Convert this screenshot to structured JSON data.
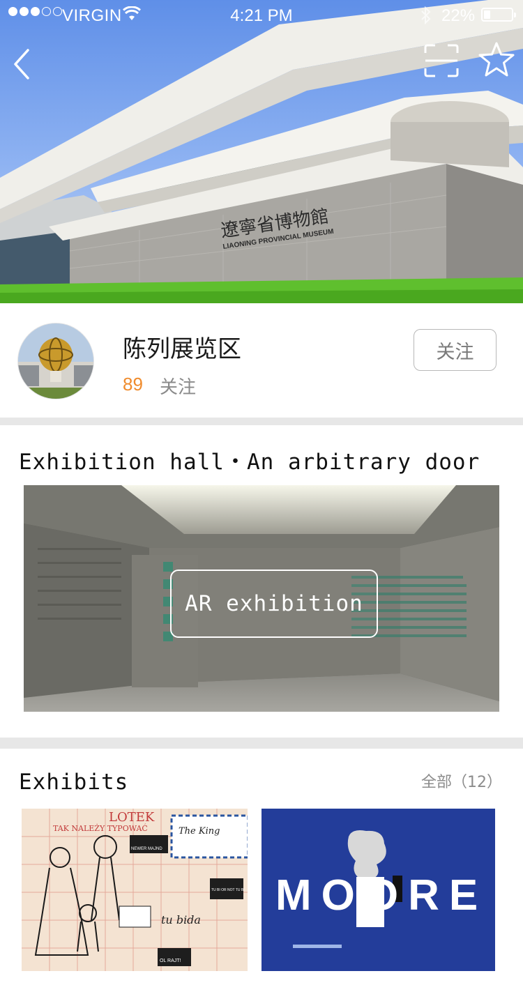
{
  "status_bar": {
    "carrier": "VIRGIN",
    "time": "4:21 PM",
    "battery": "22%",
    "battery_level": 0.22
  },
  "hero": {
    "building_sign_cn": "遼寧省博物館",
    "building_sign_en": "LIAONING PROVINCIAL MUSEUM"
  },
  "profile": {
    "name": "陈列展览区",
    "follower_count": "89",
    "follower_label": "关注",
    "follow_button": "关注"
  },
  "hall": {
    "title": "Exhibition hall・An arbitrary door",
    "ar_button": "AR exhibition"
  },
  "exhibits": {
    "title": "Exhibits",
    "all_link": "全部（12）",
    "items": [
      {
        "poster_texts": [
          "LOTEK",
          "TAK NALEŻY TYPOWAĆ",
          "The King",
          "NEWER MAJND",
          "TU BI OR NOT TU BI",
          "tu bida",
          "OL RAJT!"
        ]
      },
      {
        "poster_texts": [
          "MOORE"
        ]
      }
    ]
  },
  "colors": {
    "accent_orange": "#f08b2c",
    "divider": "#e7e7e7",
    "poster_blue": "#233d9a"
  }
}
